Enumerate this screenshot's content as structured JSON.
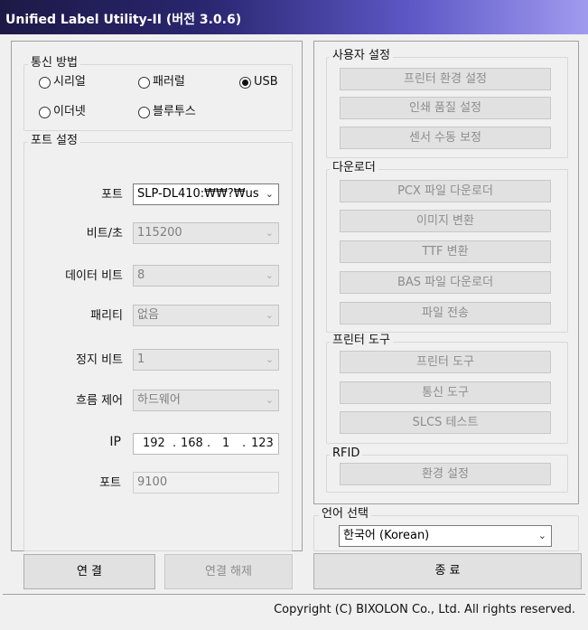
{
  "window": {
    "title": "Unified Label Utility-II (버전 3.0.6)"
  },
  "comm": {
    "legend": "통신 방법",
    "options": [
      "시리얼",
      "패러럴",
      "USB",
      "이더넷",
      "블루투스"
    ],
    "selected": "USB"
  },
  "port_settings": {
    "legend": "포트 설정",
    "port_label": "포트",
    "port_value": "SLP-DL410:₩₩?₩us",
    "baud_label": "비트/초",
    "baud_value": "115200",
    "databits_label": "데이터 비트",
    "databits_value": "8",
    "parity_label": "패리티",
    "parity_value": "없음",
    "stopbits_label": "정지 비트",
    "stopbits_value": "1",
    "flow_label": "흐름 제어",
    "flow_value": "하드웨어",
    "ip_label": "IP",
    "ip_octets": [
      "192",
      "168",
      "1",
      "123"
    ],
    "tcp_port_label": "포트",
    "tcp_port_value": "9100"
  },
  "buttons": {
    "connect": "연 결",
    "disconnect": "연결 해제",
    "exit": "종 료"
  },
  "user_settings": {
    "legend": "사용자 설정",
    "items": [
      "프린터 환경 설정",
      "인쇄 품질 설정",
      "센서 수동 보정"
    ]
  },
  "downloader": {
    "legend": "다운로더",
    "items": [
      "PCX 파일 다운로더",
      "이미지 변환",
      "TTF 변환",
      "BAS 파일 다운로더",
      "파일 전송"
    ]
  },
  "printer_tools": {
    "legend": "프린터 도구",
    "items": [
      "프린터 도구",
      "통신 도구",
      "SLCS 테스트"
    ]
  },
  "rfid": {
    "legend": "RFID",
    "items": [
      "환경 설정"
    ]
  },
  "language": {
    "legend": "언어 선택",
    "value": "한국어 (Korean)"
  },
  "footer": {
    "copyright": "Copyright (C) BIXOLON Co., Ltd. All rights reserved."
  },
  "colors": {
    "title_start": "#1d1946",
    "title_end": "#a19bef",
    "disabled_text": "#8d8d8d"
  }
}
